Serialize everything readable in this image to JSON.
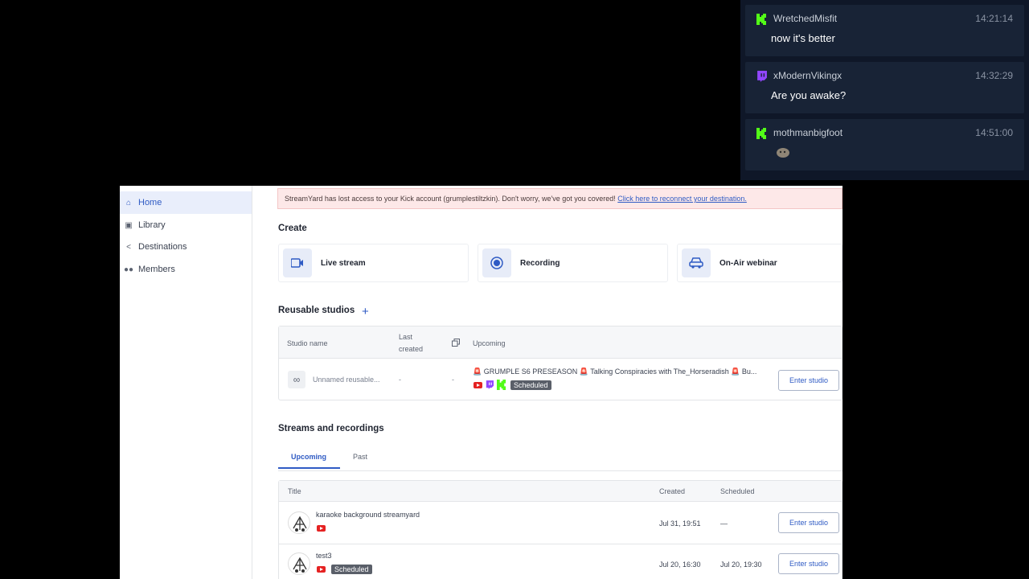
{
  "chat": {
    "messages": [
      {
        "platform": "kick",
        "user": "WretchedMisfit",
        "time": "14:21:14",
        "text": "now it's better"
      },
      {
        "platform": "twitch",
        "user": "xModernVikingx",
        "time": "14:32:29",
        "text": "Are you awake?"
      },
      {
        "platform": "kick",
        "user": "mothmanbigfoot",
        "time": "14:51:00",
        "text": ""
      }
    ]
  },
  "sidebar": {
    "items": [
      {
        "label": "Home",
        "icon": "home-icon"
      },
      {
        "label": "Library",
        "icon": "library-icon"
      },
      {
        "label": "Destinations",
        "icon": "share-icon"
      },
      {
        "label": "Members",
        "icon": "members-icon"
      }
    ]
  },
  "alert": {
    "text": "StreamYard has lost access to your Kick account (grumplestiltzkin). Don't worry, we've got you covered! ",
    "link": "Click here to reconnect your destination."
  },
  "create": {
    "title": "Create",
    "cards": [
      {
        "label": "Live stream",
        "icon": "camera-icon"
      },
      {
        "label": "Recording",
        "icon": "record-icon"
      },
      {
        "label": "On-Air webinar",
        "icon": "webinar-icon"
      }
    ]
  },
  "reusable": {
    "title": "Reusable studios",
    "headers": {
      "name": "Studio name",
      "last": "Last",
      "created": "created",
      "upcoming": "Upcoming"
    },
    "row": {
      "name": "Unnamed reusable...",
      "last": "-",
      "copy": "-",
      "upcoming": "🚨 GRUMPLE S6 PRESEASON 🚨 Talking Conspiracies with The_Horseradish 🚨 Bu...",
      "badge": "Scheduled",
      "button": "Enter studio"
    }
  },
  "streams": {
    "title": "Streams and recordings",
    "tabs": [
      "Upcoming",
      "Past"
    ],
    "headers": {
      "title": "Title",
      "created": "Created",
      "scheduled": "Scheduled"
    },
    "rows": [
      {
        "title": "karaoke background streamyard",
        "badge": "",
        "created": "Jul 31, 19:51",
        "scheduled": "—",
        "button": "Enter studio"
      },
      {
        "title": "test3",
        "badge": "Scheduled",
        "created": "Jul 20, 16:30",
        "scheduled": "Jul 20, 19:30",
        "button": "Enter studio"
      }
    ]
  },
  "colors": {
    "accent": "#2f5bc4",
    "kick": "#53fc18",
    "twitch": "#9146ff",
    "youtube": "#e52222"
  }
}
